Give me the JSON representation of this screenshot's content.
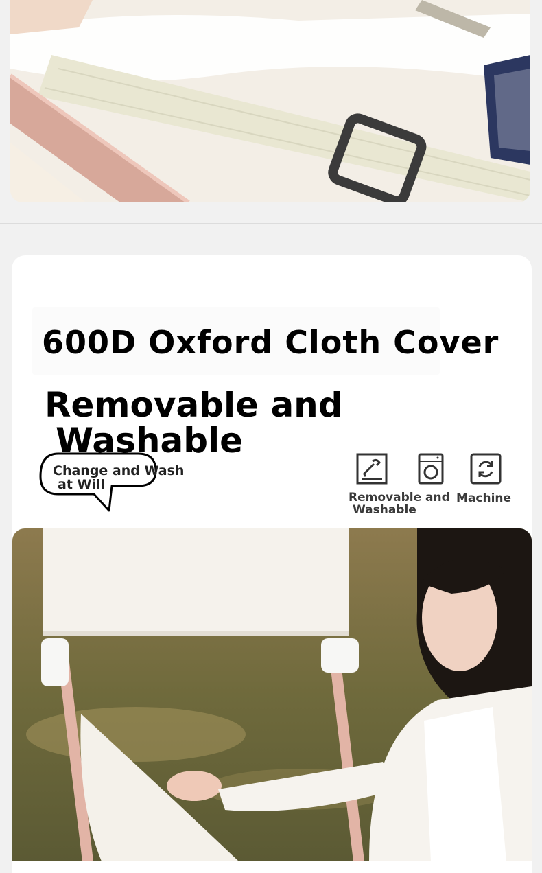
{
  "header": {
    "title": "600D Oxford Cloth Cover",
    "subtitle_line1": "Removable and",
    "subtitle_line2": "Washable"
  },
  "callout": {
    "line1": "Change and Wash",
    "line2": "at Will"
  },
  "features": [
    {
      "icon": "detachable-icon",
      "label_line1": "Removable and",
      "label_line2": "Washable"
    },
    {
      "icon": "washing-machine-icon",
      "label_line1": "Machine"
    },
    {
      "icon": "refresh-icon"
    }
  ],
  "colors": {
    "text": "#000000",
    "card_bg": "#ffffff",
    "page_bg": "#f1f1f1",
    "chair_frame": "#e2b4a6"
  }
}
